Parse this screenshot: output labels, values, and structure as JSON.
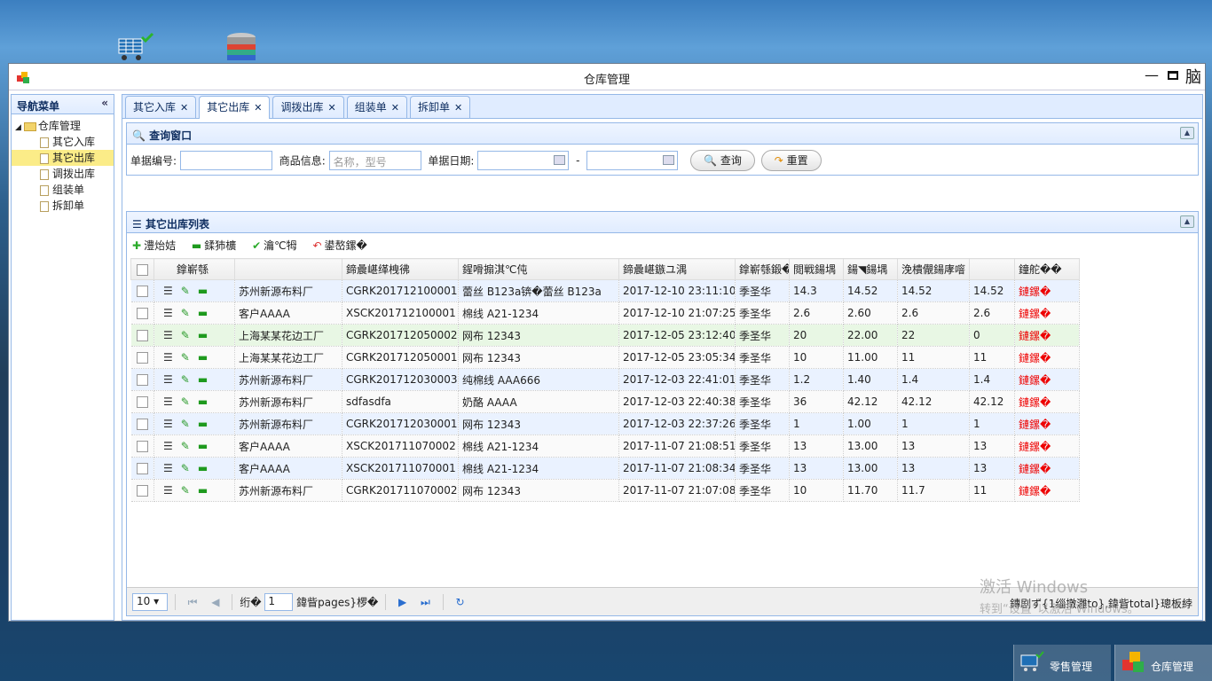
{
  "window": {
    "title": "仓库管理",
    "close_glyph": "脑"
  },
  "nav": {
    "title": "导航菜单",
    "root": "仓库管理",
    "items": [
      {
        "label": "其它入库",
        "selected": false
      },
      {
        "label": "其它出库",
        "selected": true
      },
      {
        "label": "调拨出库",
        "selected": false
      },
      {
        "label": "组装单",
        "selected": false
      },
      {
        "label": "拆卸单",
        "selected": false
      }
    ]
  },
  "tabs": [
    {
      "label": "其它入库",
      "active": false
    },
    {
      "label": "其它出库",
      "active": true
    },
    {
      "label": "调拨出库",
      "active": false
    },
    {
      "label": "组装单",
      "active": false
    },
    {
      "label": "拆卸单",
      "active": false
    }
  ],
  "query": {
    "title": "查询窗口",
    "doc_no_label": "单据编号:",
    "goods_label": "商品信息:",
    "goods_placeholder": "名称，型号",
    "date_label": "单据日期:",
    "date_sep": "-",
    "search_btn": "查询",
    "reset_btn": "重置"
  },
  "list": {
    "title": "其它出库列表",
    "toolbar": [
      "澧炲姞",
      "鍒犻櫎",
      "瀹℃牳",
      "鍙嶅鏍�"
    ],
    "columns": [
      "鎿嶄綔",
      "",
      "鍗曟嵁缂栧彿",
      "鍟嗗搧淇℃伅",
      "鍗曟嵁鏃ユ湡",
      "鎿嶄綔鍛�",
      "閲戦鍚堣",
      "鍚◥鍚堣",
      "浼樻儬鍚庨噾",
      "",
      "鐘舵��"
    ],
    "rows": [
      [
        "苏州新源布料厂",
        "CGRK201712100001",
        "蕾丝 B123a锛�蕾丝 B123a",
        "2017-12-10 23:11:10",
        "季圣华",
        "14.3",
        "14.52",
        "14.52",
        "14.52",
        "鏈鏍�"
      ],
      [
        "客户AAAA",
        "XSCK201712100001",
        "棉线 A21-1234",
        "2017-12-10 21:07:25",
        "季圣华",
        "2.6",
        "2.60",
        "2.6",
        "2.6",
        "鏈鏍�"
      ],
      [
        "上海某某花边工厂",
        "CGRK201712050002",
        "网布 12343",
        "2017-12-05 23:12:40",
        "季圣华",
        "20",
        "22.00",
        "22",
        "0",
        "鏈鏍�"
      ],
      [
        "上海某某花边工厂",
        "CGRK201712050001",
        "网布 12343",
        "2017-12-05 23:05:34",
        "季圣华",
        "10",
        "11.00",
        "11",
        "11",
        "鏈鏍�"
      ],
      [
        "苏州新源布料厂",
        "CGRK201712030003",
        "纯棉线 AAA666",
        "2017-12-03 22:41:01",
        "季圣华",
        "1.2",
        "1.40",
        "1.4",
        "1.4",
        "鏈鏍�"
      ],
      [
        "苏州新源布料厂",
        "sdfasdfa",
        "奶酪 AAAA",
        "2017-12-03 22:40:38",
        "季圣华",
        "36",
        "42.12",
        "42.12",
        "42.12",
        "鏈鏍�"
      ],
      [
        "苏州新源布料厂",
        "CGRK201712030001",
        "网布 12343",
        "2017-12-03 22:37:26",
        "季圣华",
        "1",
        "1.00",
        "1",
        "1",
        "鏈鏍�"
      ],
      [
        "客户AAAA",
        "XSCK201711070002",
        "棉线 A21-1234",
        "2017-11-07 21:08:51",
        "季圣华",
        "13",
        "13.00",
        "13",
        "13",
        "鏈鏍�"
      ],
      [
        "客户AAAA",
        "XSCK201711070001",
        "棉线 A21-1234",
        "2017-11-07 21:08:34",
        "季圣华",
        "13",
        "13.00",
        "13",
        "13",
        "鏈鏍�"
      ],
      [
        "苏州新源布料厂",
        "CGRK201711070002",
        "网布 12343",
        "2017-11-07 21:07:08",
        "季圣华",
        "10",
        "11.70",
        "11.7",
        "11",
        "鏈鏍�"
      ]
    ]
  },
  "pager": {
    "page_size": "10",
    "page_label_before": "绗�",
    "page_value": "1",
    "page_label_after": "鍏眥pages}椤�",
    "info": "鏄剧ず{1缁撴灉to},鍏眥total}璁板綍"
  },
  "watermark": {
    "line1": "激活 Windows",
    "line2": "转到“设置”以激活 Windows。"
  },
  "taskbar": [
    {
      "label": "零售管理"
    },
    {
      "label": "仓库管理"
    }
  ]
}
